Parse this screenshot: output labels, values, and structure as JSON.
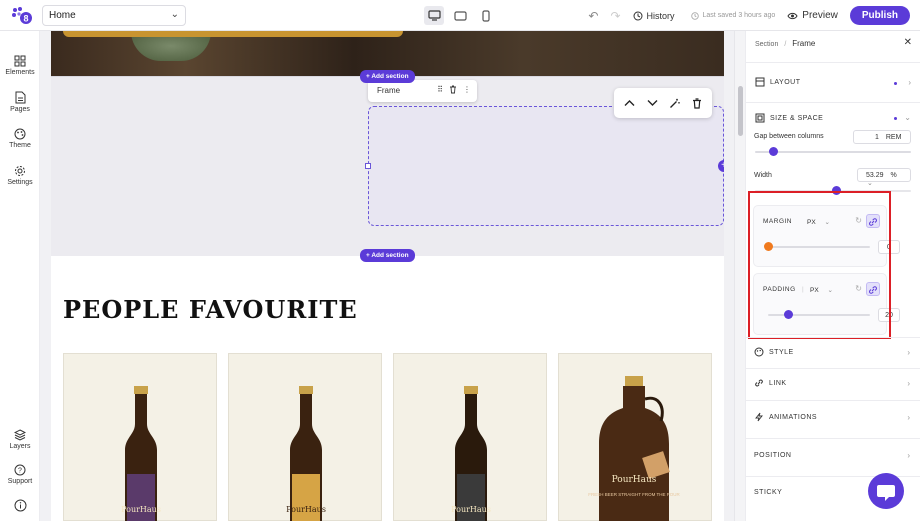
{
  "topbar": {
    "page_select_value": "Home",
    "history_label": "History",
    "saved_label": "Last saved 3 hours ago",
    "preview_label": "Preview",
    "publish_label": "Publish"
  },
  "leftbar": {
    "items": [
      {
        "label": "Elements"
      },
      {
        "label": "Pages"
      },
      {
        "label": "Theme"
      },
      {
        "label": "Settings"
      },
      {
        "label": "Layers"
      },
      {
        "label": "Support"
      }
    ]
  },
  "canvas": {
    "add_section_label": "+ Add section",
    "frame_label": "Frame",
    "heading": "PEOPLE FAVOURITE",
    "products": [
      {
        "brand": "PourHaus",
        "label_color": "#5a3a6a"
      },
      {
        "brand": "PourHaus",
        "label_color": "#d6a445"
      },
      {
        "brand": "PourHaus",
        "label_color": "#3a3a3a"
      },
      {
        "brand": "PourHaus",
        "label_color": "#c9442f",
        "growler_text": "FRESH BEER STRAIGHT FROM THE POUR"
      }
    ]
  },
  "panel": {
    "breadcrumb_parent": "Section",
    "breadcrumb_sep": "/",
    "breadcrumb_current": "Frame",
    "layout_label": "LAYOUT",
    "size_space_label": "SIZE & SPACE",
    "gap_label": "Gap between columns",
    "gap_value": "1",
    "gap_unit": "REM",
    "width_label": "Width",
    "width_value": "53.29",
    "width_unit": "%",
    "margin_label": "MARGIN",
    "margin_unit": "PX",
    "margin_value": "0",
    "padding_label": "PADDING",
    "padding_unit": "PX",
    "padding_value": "20",
    "style_label": "STYLE",
    "link_label": "LINK",
    "animations_label": "ANIMATIONS",
    "position_label": "POSITION",
    "sticky_label": "STICKY"
  },
  "colors": {
    "accent": "#5b3bd8",
    "highlight": "#dc1f26",
    "margin_knob": "#f07a1f"
  }
}
